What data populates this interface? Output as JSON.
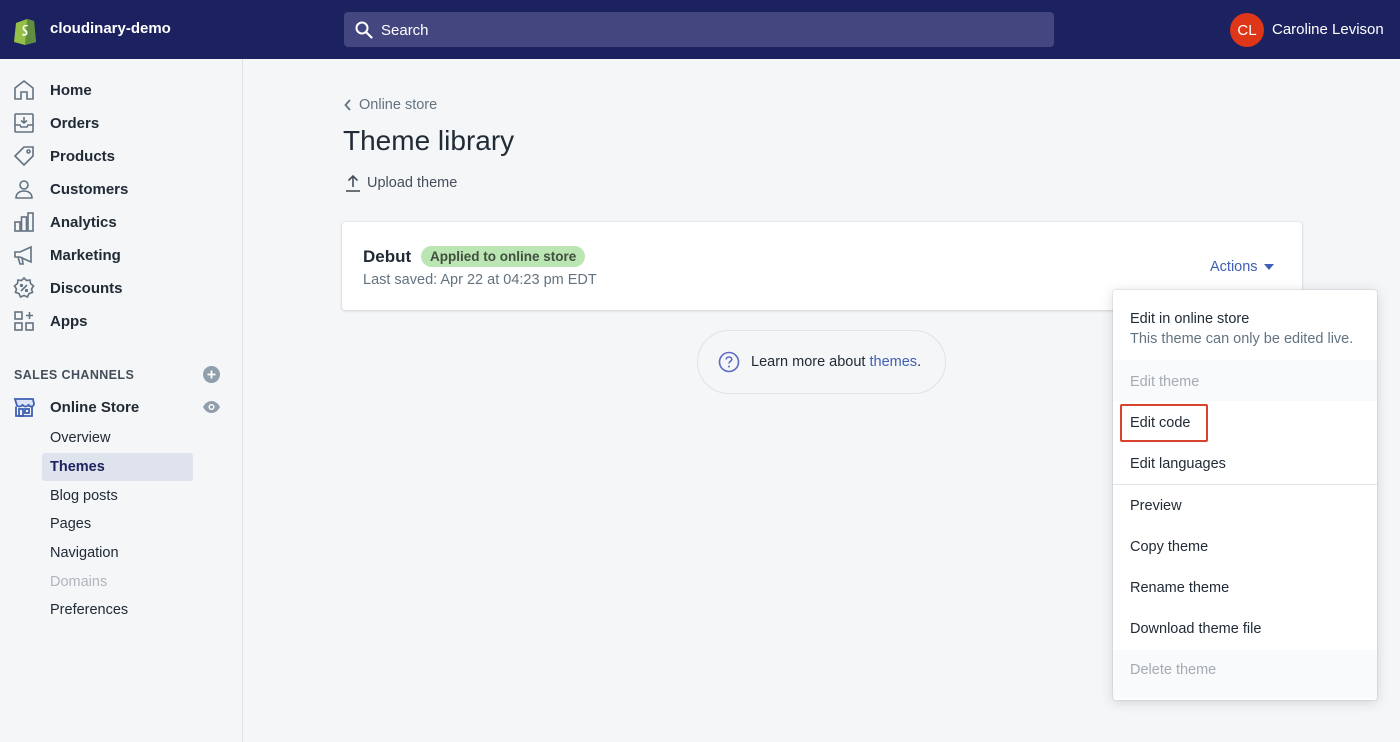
{
  "topbar": {
    "store_name": "cloudinary-demo",
    "search_placeholder": "Search",
    "avatar_initials": "CL",
    "user_name": "Caroline Levison",
    "bg_color": "#1c2260",
    "avatar_color": "#de3618"
  },
  "sidebar": {
    "items": [
      {
        "label": "Home",
        "icon": "home-icon"
      },
      {
        "label": "Orders",
        "icon": "orders-icon"
      },
      {
        "label": "Products",
        "icon": "tag-icon"
      },
      {
        "label": "Customers",
        "icon": "person-icon"
      },
      {
        "label": "Analytics",
        "icon": "bar-chart-icon"
      },
      {
        "label": "Marketing",
        "icon": "megaphone-icon"
      },
      {
        "label": "Discounts",
        "icon": "discount-icon"
      },
      {
        "label": "Apps",
        "icon": "apps-icon"
      }
    ],
    "sales_channels_title": "SALES CHANNELS",
    "online_store_label": "Online Store",
    "sub_items": [
      {
        "label": "Overview",
        "state": "normal"
      },
      {
        "label": "Themes",
        "state": "active"
      },
      {
        "label": "Blog posts",
        "state": "normal"
      },
      {
        "label": "Pages",
        "state": "normal"
      },
      {
        "label": "Navigation",
        "state": "normal"
      },
      {
        "label": "Domains",
        "state": "disabled"
      },
      {
        "label": "Preferences",
        "state": "normal"
      }
    ]
  },
  "main": {
    "breadcrumb": "Online store",
    "title": "Theme library",
    "upload_label": "Upload theme",
    "theme": {
      "name": "Debut",
      "badge": "Applied to online store",
      "last_saved": "Last saved: Apr 22 at 04:23 pm EDT",
      "actions_label": "Actions"
    },
    "learn_more": {
      "prefix": "Learn more about ",
      "link": "themes",
      "suffix": "."
    }
  },
  "menu": {
    "edit_online": "Edit in online store",
    "edit_online_note": "This theme can only be edited live.",
    "edit_theme": "Edit theme",
    "edit_code": "Edit code",
    "edit_languages": "Edit languages",
    "preview": "Preview",
    "copy_theme": "Copy theme",
    "rename_theme": "Rename theme",
    "download_theme": "Download theme file",
    "delete_theme": "Delete theme",
    "highlight_color": "#d8432e"
  }
}
